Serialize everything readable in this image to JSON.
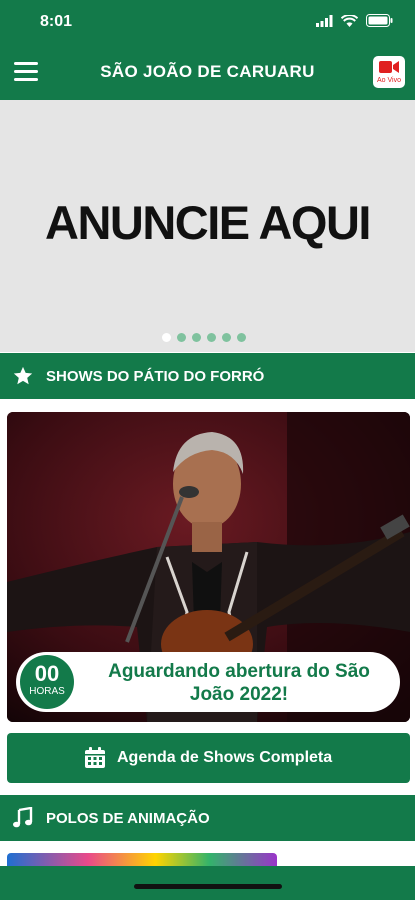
{
  "status_bar": {
    "time": "8:01"
  },
  "header": {
    "title": "SÃO JOÃO DE CARUARU",
    "live_label": "Ao Vivo"
  },
  "banner": {
    "text": "ANUNCIE AQUI",
    "slide_count": 6,
    "active_slide": 0
  },
  "sections": {
    "shows": {
      "title": "SHOWS DO PÁTIO DO FORRÓ",
      "icon": "star-icon"
    },
    "polos": {
      "title": "POLOS DE ANIMAÇÃO",
      "icon": "music-note-icon"
    }
  },
  "show_card": {
    "countdown_value": "00",
    "countdown_unit": "HORAS",
    "message": "Aguardando abertura do São João 2022!"
  },
  "agenda_button": {
    "label": "Agenda de Shows Completa",
    "icon": "calendar-icon"
  },
  "colors": {
    "primary": "#137a4a",
    "banner_bg": "#e5e5e5",
    "live_red": "#e02020"
  }
}
